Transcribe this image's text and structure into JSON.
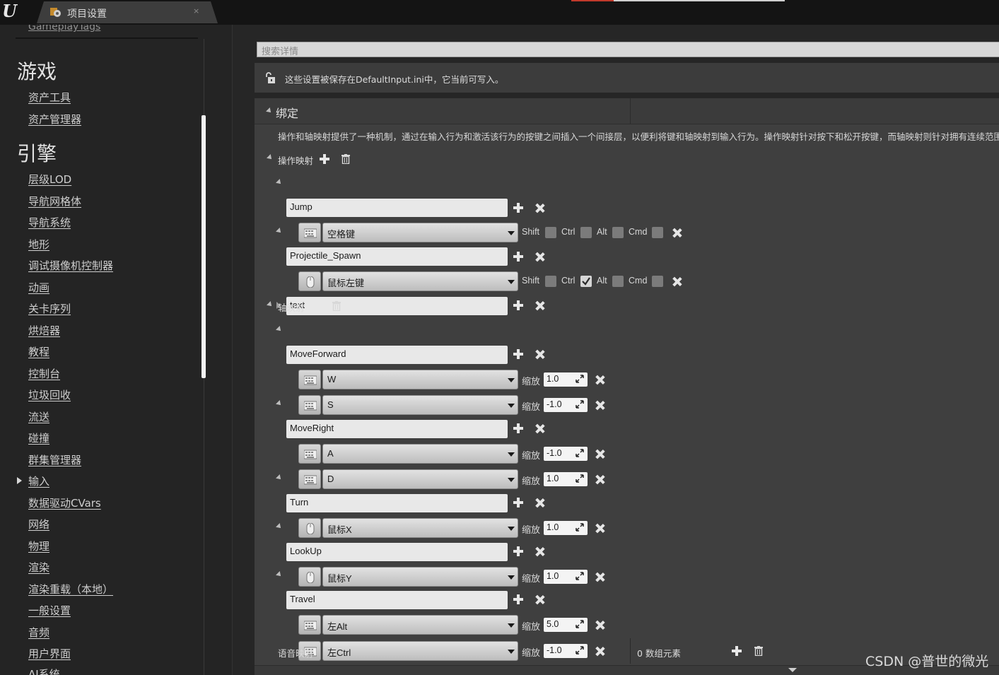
{
  "app": {
    "logo_text": "U",
    "tab_title": "项目设置",
    "tab_close": "×"
  },
  "sidebar": {
    "cut_item": "GameplayTags",
    "sections": [
      {
        "heading": "游戏",
        "items": [
          "资产工具",
          "资产管理器"
        ]
      },
      {
        "heading": "引擎",
        "items": [
          "层级LOD",
          "导航网格体",
          "导航系统",
          "地形",
          "调试摄像机控制器",
          "动画",
          "关卡序列",
          "烘焙器",
          "教程",
          "控制台",
          "垃圾回收",
          "流送",
          "碰撞",
          "群集管理器",
          "输入",
          "数据驱动CVars",
          "网络",
          "物理",
          "渲染",
          "渲染重载（本地）",
          "一般设置",
          "音频",
          "用户界面",
          "AI系统"
        ]
      }
    ],
    "selected_item": "输入"
  },
  "main": {
    "search_placeholder": "搜索详情",
    "notice": "这些设置被保存在DefaultInput.ini中，它当前可写入。",
    "section_title": "绑定",
    "description": "操作和轴映射提供了一种机制，通过在输入行为和激活该行为的按键之间插入一个间接层，以便利将键和轴映射到输入行为。操作映射针对按下和松开按键，而轴映射则针对拥有连续范围的输入。",
    "action_label": "操作映射",
    "axis_label": "轴映射",
    "speech_label": "语音映射",
    "speech_count": "0 数组元素",
    "modifiers": [
      "Shift",
      "Ctrl",
      "Alt",
      "Cmd"
    ],
    "scale_label": "缩放",
    "action_mappings": [
      {
        "name": "Jump",
        "key": "空格键",
        "device": "keyboard",
        "shift": false,
        "ctrl": false,
        "alt": false,
        "cmd": false
      },
      {
        "name": "Projectile_Spawn",
        "key": "鼠标左键",
        "device": "mouse",
        "shift": false,
        "ctrl": true,
        "alt": false,
        "cmd": false
      },
      {
        "name": "text"
      }
    ],
    "axis_mappings": [
      {
        "name": "MoveForward",
        "keys": [
          {
            "key": "W",
            "device": "keyboard",
            "scale": "1.0"
          },
          {
            "key": "S",
            "device": "keyboard",
            "scale": "-1.0"
          }
        ]
      },
      {
        "name": "MoveRight",
        "keys": [
          {
            "key": "A",
            "device": "keyboard",
            "scale": "-1.0"
          },
          {
            "key": "D",
            "device": "keyboard",
            "scale": "1.0"
          }
        ]
      },
      {
        "name": "Turn",
        "keys": [
          {
            "key": "鼠标X",
            "device": "mouse",
            "scale": "1.0"
          }
        ]
      },
      {
        "name": "LookUp",
        "keys": [
          {
            "key": "鼠标Y",
            "device": "mouse",
            "scale": "1.0"
          }
        ]
      },
      {
        "name": "Travel",
        "keys": [
          {
            "key": "左Alt",
            "device": "keyboard",
            "scale": "5.0"
          },
          {
            "key": "左Ctrl",
            "device": "keyboard",
            "scale": "-1.0"
          }
        ]
      }
    ]
  },
  "watermark": "CSDN @普世的微光",
  "colors": {
    "accent_red": "#c0392b",
    "panel": "#3f3f3f",
    "background": "#262626"
  }
}
